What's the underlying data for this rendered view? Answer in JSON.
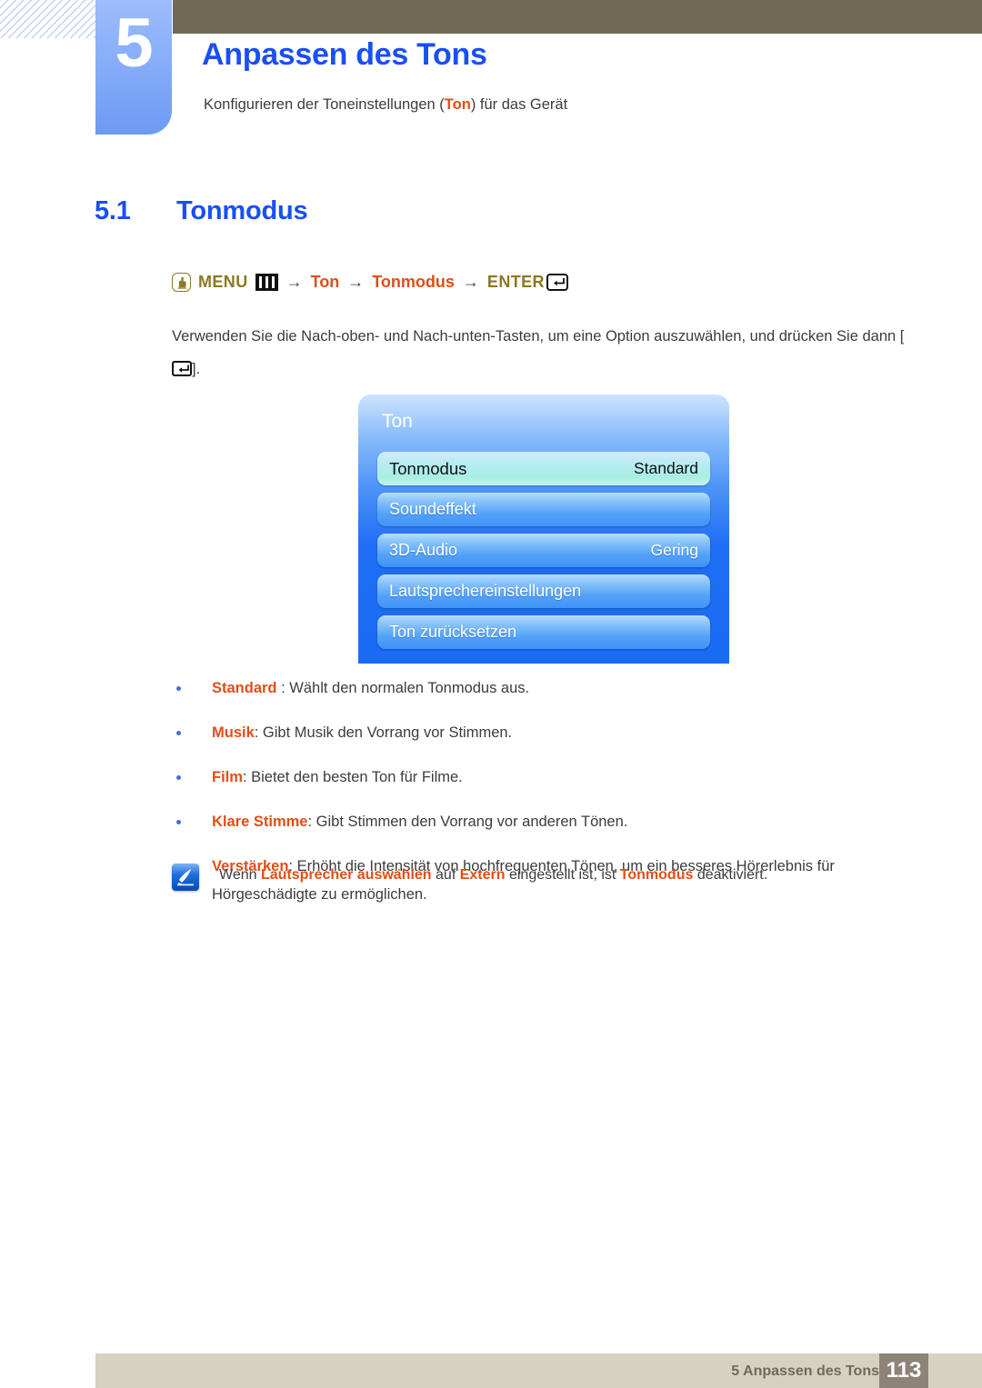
{
  "header": {
    "chapter_number": "5",
    "chapter_title": "Anpassen des Tons",
    "subtitle_before": "Konfigurieren der Toneinstellungen (",
    "subtitle_keyword": "Ton",
    "subtitle_after": ") für das Gerät"
  },
  "section": {
    "number": "5.1",
    "title": "Tonmodus"
  },
  "menu_path": {
    "hand_icon": "hand-press-icon",
    "menu_label": "MENU",
    "menu_bars_icon": "menu-bars-icon",
    "arrow1": "→",
    "item1": "Ton",
    "arrow2": "→",
    "item2": "Tonmodus",
    "arrow3": "→",
    "enter_label": "ENTER",
    "enter_icon": "enter-key-icon"
  },
  "paragraph": {
    "text_before": "Verwenden Sie die Nach-oben- und Nach-unten-Tasten, um eine Option auszuwählen, und drücken Sie dann [",
    "text_after": "]."
  },
  "osd": {
    "title": "Ton",
    "rows": [
      {
        "label": "Tonmodus",
        "value": "Standard",
        "selected": true
      },
      {
        "label": "Soundeffekt",
        "value": "",
        "selected": false
      },
      {
        "label": "3D-Audio",
        "value": "Gering",
        "selected": false
      },
      {
        "label": "Lautsprechereinstellungen",
        "value": "",
        "selected": false
      },
      {
        "label": "Ton zurücksetzen",
        "value": "",
        "selected": false
      }
    ]
  },
  "bullets": [
    {
      "term": "Standard",
      "rest": " : Wählt den normalen Tonmodus aus."
    },
    {
      "term": "Musik",
      "rest": ": Gibt Musik den Vorrang vor Stimmen."
    },
    {
      "term": "Film",
      "rest": ": Bietet den besten Ton für Filme."
    },
    {
      "term": "Klare Stimme",
      "rest": ": Gibt Stimmen den Vorrang vor anderen Tönen."
    },
    {
      "term": "Verstärken",
      "rest": ": Erhöht die Intensität von hochfrequenten Tönen, um ein besseres Hörerlebnis für Hörgeschädigte zu ermöglichen."
    }
  ],
  "note": {
    "icon": "note-pen-icon",
    "part1": "Wenn ",
    "kw1": "Lautsprecher auswählen",
    "part2": " auf ",
    "kw2": "Extern",
    "part3": " eingestellt ist, ist ",
    "kw3": "Tonmodus",
    "part4": " deaktiviert."
  },
  "footer": {
    "text": "5 Anpassen des Tons",
    "page": "113"
  },
  "colors": {
    "accent_blue": "#1a4ff5",
    "accent_orange": "#e04e17",
    "olive_bar": "#6e6a55",
    "menu_olive": "#8a7a21",
    "footer_bar": "#d6d2c0",
    "footer_page": "#8d8477",
    "osd_blue": "#1f6ef5"
  }
}
